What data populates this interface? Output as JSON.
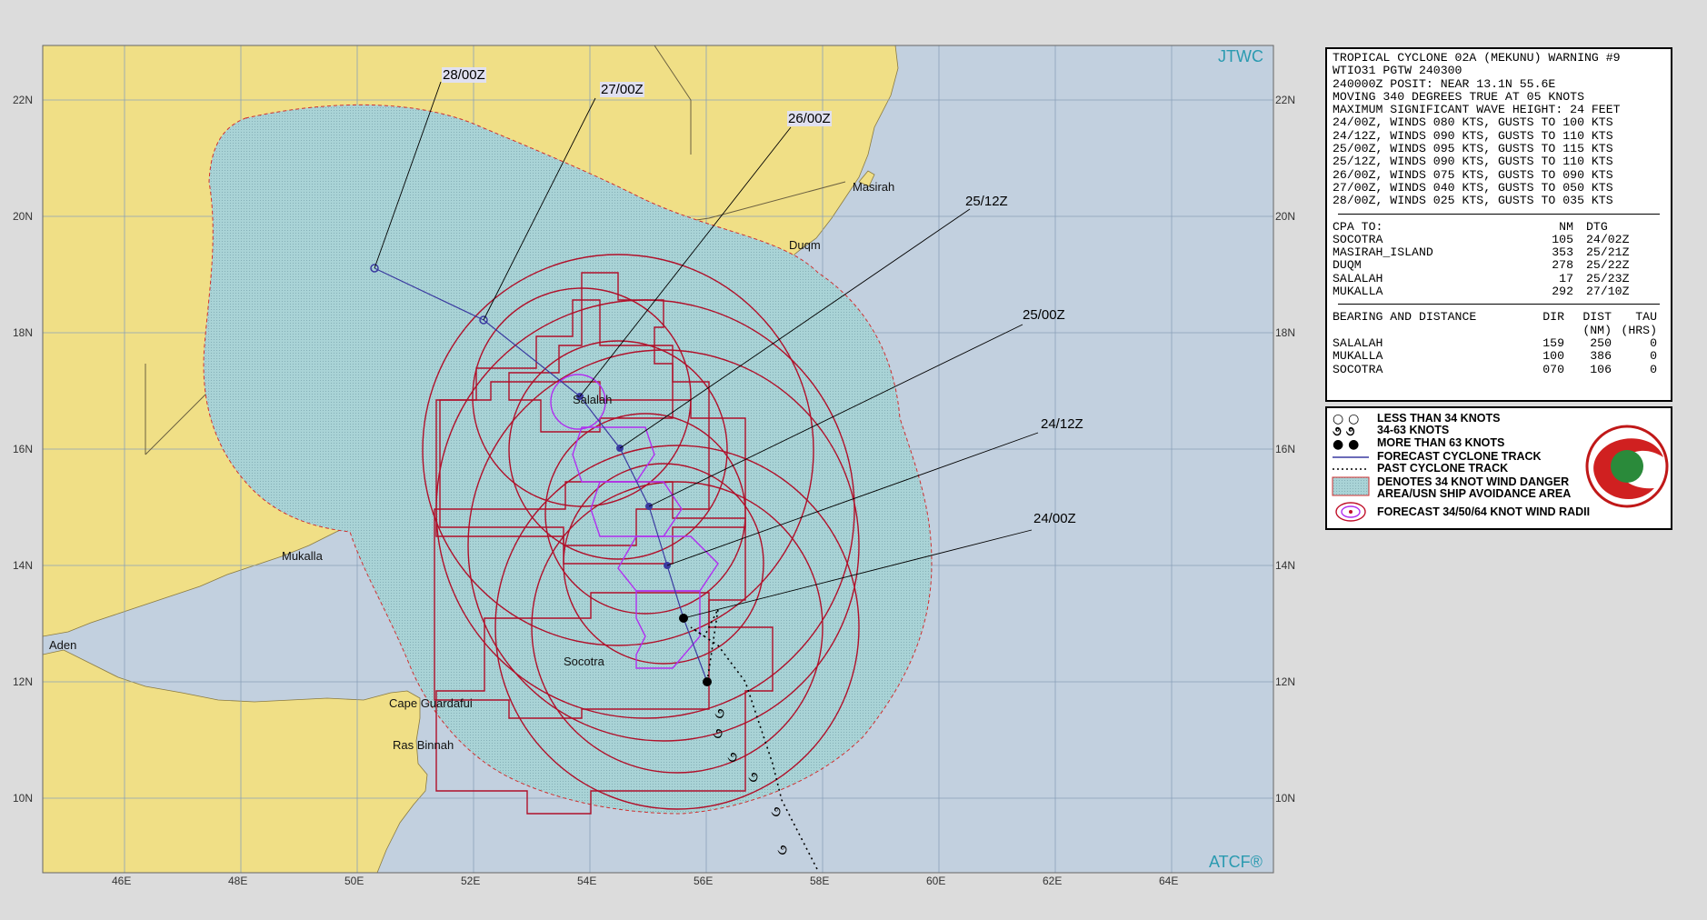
{
  "map": {
    "agency": "JTWC",
    "software": "ATCF®",
    "lat_labels": [
      "22N",
      "20N",
      "18N",
      "16N",
      "14N",
      "12N",
      "10N"
    ],
    "lon_labels": [
      "46E",
      "48E",
      "50E",
      "52E",
      "54E",
      "56E",
      "58E",
      "60E",
      "62E",
      "64E"
    ],
    "places": [
      "Masirah",
      "Duqm",
      "Salalah",
      "Mukalla",
      "Aden",
      "Socotra",
      "Cape Guardafui",
      "Ras Binnah"
    ],
    "forecast_times": [
      "28/00Z",
      "27/00Z",
      "26/00Z",
      "25/12Z",
      "25/00Z",
      "24/12Z",
      "24/00Z"
    ],
    "colors": {
      "land": "#f0df86",
      "sea": "#c2d0df",
      "danger_area": "#a6d4d8",
      "wind_34": "#b0102a",
      "wind_50": "#c0102a",
      "wind_64": "#b030f0",
      "track": "#3a3aa0"
    }
  },
  "info": {
    "lines": [
      "TROPICAL CYCLONE 02A (MEKUNU) WARNING #9",
      "WTIO31 PGTW 240300",
      "240000Z POSIT: NEAR 13.1N 55.6E",
      "MOVING 340 DEGREES TRUE AT 05 KNOTS",
      "MAXIMUM SIGNIFICANT WAVE HEIGHT: 24 FEET",
      "24/00Z, WINDS 080 KTS, GUSTS TO 100 KTS",
      "24/12Z, WINDS 090 KTS, GUSTS TO 110 KTS",
      "25/00Z, WINDS 095 KTS, GUSTS TO 115 KTS",
      "25/12Z, WINDS 090 KTS, GUSTS TO 110 KTS",
      "26/00Z, WINDS 075 KTS, GUSTS TO 090 KTS",
      "27/00Z, WINDS 040 KTS, GUSTS TO 050 KTS",
      "28/00Z, WINDS 025 KTS, GUSTS TO 035 KTS"
    ],
    "cpa_header": {
      "name": "CPA TO:",
      "nm": "NM",
      "dtg": "DTG"
    },
    "cpa": [
      {
        "name": "SOCOTRA",
        "nm": "105",
        "dtg": "24/02Z"
      },
      {
        "name": "MASIRAH_ISLAND",
        "nm": "353",
        "dtg": "25/21Z"
      },
      {
        "name": "DUQM",
        "nm": "278",
        "dtg": "25/22Z"
      },
      {
        "name": "SALALAH",
        "nm": "17",
        "dtg": "25/23Z"
      },
      {
        "name": "MUKALLA",
        "nm": "292",
        "dtg": "27/10Z"
      }
    ],
    "bd_header": {
      "name": "BEARING AND DISTANCE",
      "dir": "DIR",
      "dist": "DIST",
      "tau": "TAU",
      "dist_unit": "(NM)",
      "tau_unit": "(HRS)"
    },
    "bd": [
      {
        "name": "SALALAH",
        "dir": "159",
        "dist": "250",
        "tau": "0"
      },
      {
        "name": "MUKALLA",
        "dir": "100",
        "dist": "386",
        "tau": "0"
      },
      {
        "name": "SOCOTRA",
        "dir": "070",
        "dist": "106",
        "tau": "0"
      }
    ]
  },
  "legend": {
    "items": [
      "LESS THAN 34 KNOTS",
      "34-63 KNOTS",
      "MORE THAN 63 KNOTS",
      "FORECAST CYCLONE TRACK",
      "PAST CYCLONE TRACK",
      "DENOTES 34 KNOT WIND DANGER",
      "AREA/USN SHIP AVOIDANCE AREA",
      "FORECAST 34/50/64 KNOT WIND RADII"
    ]
  }
}
